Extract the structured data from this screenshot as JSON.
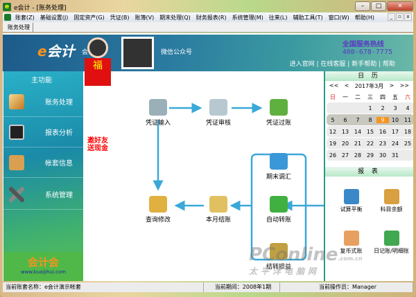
{
  "window": {
    "title": "e会计 - [账务处理]",
    "app_icon": "e"
  },
  "menu": [
    "账套(Z)",
    "基础设置(J)",
    "固定资产(G)",
    "凭证(B)",
    "账簿(V)",
    "期末处理(Q)",
    "财务报表(R)",
    "系统管理(M)",
    "往来(L)",
    "辅助工具(T)",
    "窗口(W)",
    "帮助(H)"
  ],
  "tab": "账务处理",
  "banner": {
    "logo_e": "e",
    "logo_text": "会计",
    "client": "会计端",
    "wechat": "微信公众号",
    "hotline_label": "全国服务热线",
    "hotline": "400-678-7775",
    "links": [
      "进入官网",
      "在线客服",
      "新手帮助",
      "帮助"
    ]
  },
  "left": {
    "header": "主功能",
    "items": [
      "账务处理",
      "报表分析",
      "帐套信息",
      "系统管理"
    ],
    "logo": "会计会",
    "url": "www.kuaijihui.com"
  },
  "promo": {
    "char": "福",
    "text1": "邀好友",
    "text2": "送现金"
  },
  "flow": {
    "nodes": [
      "凭证输入",
      "凭证审核",
      "凭证过账",
      "期末调汇",
      "自动转账",
      "结转损益",
      "本月结账",
      "查询修改"
    ]
  },
  "calendar": {
    "title": "日 历",
    "prev_year": "<<",
    "prev": "<",
    "month": "2017年3月",
    "next": ">",
    "next_year": ">>",
    "weekdays": [
      "日",
      "一",
      "二",
      "三",
      "四",
      "五",
      "六"
    ],
    "weeks": [
      [
        "",
        "",
        "",
        "1",
        "2",
        "3",
        "4"
      ],
      [
        "5",
        "6",
        "7",
        "8",
        "9",
        "10",
        "11"
      ],
      [
        "12",
        "13",
        "14",
        "15",
        "16",
        "17",
        "18"
      ],
      [
        "19",
        "20",
        "21",
        "22",
        "23",
        "24",
        "25"
      ],
      [
        "26",
        "27",
        "28",
        "29",
        "30",
        "31",
        ""
      ]
    ],
    "today": "9"
  },
  "reports": {
    "title": "报 表",
    "items": [
      "试算平衡",
      "科目余额",
      "复币式账",
      "日记账/明细账"
    ]
  },
  "status": {
    "book": "当前账套名称：e会计演示帐套",
    "period": "当前期间：2008年1期",
    "operator": "当前操作员：Manager"
  },
  "watermark": {
    "brand": "PConline",
    "domain": ".com.cn",
    "cn": "太平洋电脑网"
  }
}
